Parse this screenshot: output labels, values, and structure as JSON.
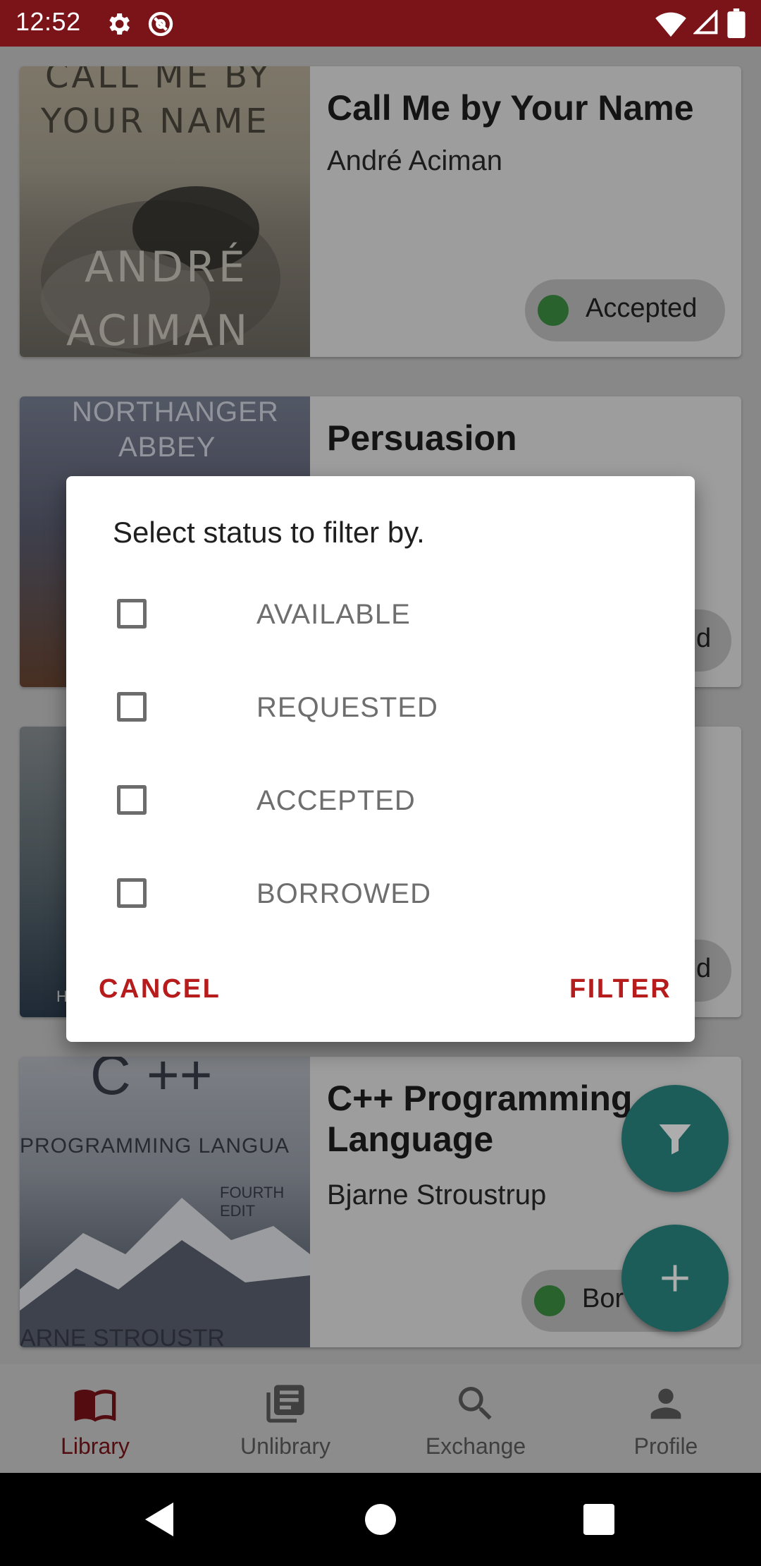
{
  "status_bar": {
    "time": "12:52"
  },
  "books": [
    {
      "title": "Call Me by Your Name",
      "author": "André Aciman",
      "status": "Accepted",
      "cover_text": [
        "CALL ME BY",
        "YOUR NAME",
        "ANDRÉ",
        "ACIMAN"
      ]
    },
    {
      "title": "Persuasion",
      "author": "",
      "status": "d",
      "cover_text": [
        "NORTHANGER",
        "ABBEY"
      ]
    },
    {
      "title": "",
      "author": "",
      "status": "d",
      "cover_text": [
        "H"
      ]
    },
    {
      "title": "C++ Programming Language",
      "author": "Bjarne Stroustrup",
      "status": "Bor",
      "cover_text": [
        "C ++",
        "PROGRAMMING LANGUA",
        "FOURTH EDIT",
        "ARNE STROUSTR"
      ]
    }
  ],
  "dialog": {
    "title": "Select status to filter by.",
    "options": [
      {
        "label": "AVAILABLE",
        "checked": false
      },
      {
        "label": "REQUESTED",
        "checked": false
      },
      {
        "label": "ACCEPTED",
        "checked": false
      },
      {
        "label": "BORROWED",
        "checked": false
      }
    ],
    "cancel": "CANCEL",
    "confirm": "FILTER"
  },
  "fabs": {
    "filter_icon": "filter-icon",
    "add_icon": "plus-icon"
  },
  "bottom_nav": [
    {
      "label": "Library",
      "icon": "book-open-icon",
      "active": true
    },
    {
      "label": "Unlibrary",
      "icon": "library-books-icon",
      "active": false
    },
    {
      "label": "Exchange",
      "icon": "search-icon",
      "active": false
    },
    {
      "label": "Profile",
      "icon": "person-icon",
      "active": false
    }
  ],
  "colors": {
    "primary": "#7b1418",
    "accent": "#b71c1c",
    "fab": "#2b8a83",
    "status_dot": "#3d9142"
  }
}
